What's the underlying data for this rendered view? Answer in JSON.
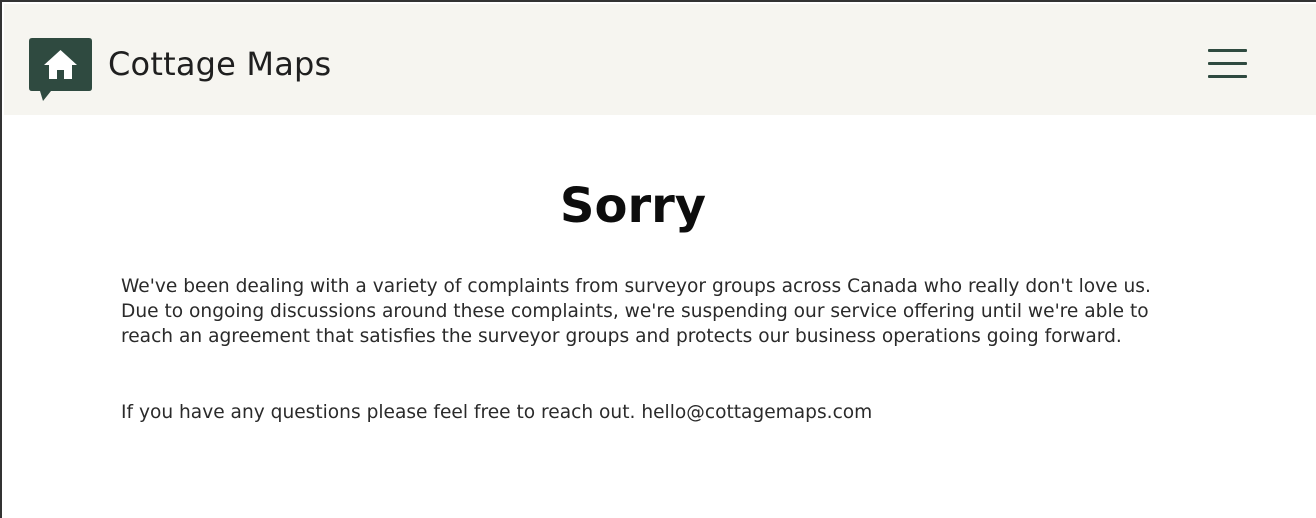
{
  "header": {
    "brand_name": "Cottage Maps",
    "logo_icon": "house-speech-bubble-icon",
    "menu_icon": "hamburger-menu-icon"
  },
  "main": {
    "title": "Sorry",
    "message": "We've been dealing with a variety of complaints from surveyor groups across Canada who really don't love us. Due to ongoing discussions around these complaints, we're suspending our service offering until we're able to reach an agreement that satisfies the surveyor groups and protects our business operations going forward.",
    "contact_text": "If you have any questions please feel free to reach out.",
    "contact_email": "hello@cottagemaps.com"
  },
  "colors": {
    "brand_dark_green": "#2f4a40",
    "header_background": "#f6f5f0",
    "page_background": "#ffffff"
  }
}
